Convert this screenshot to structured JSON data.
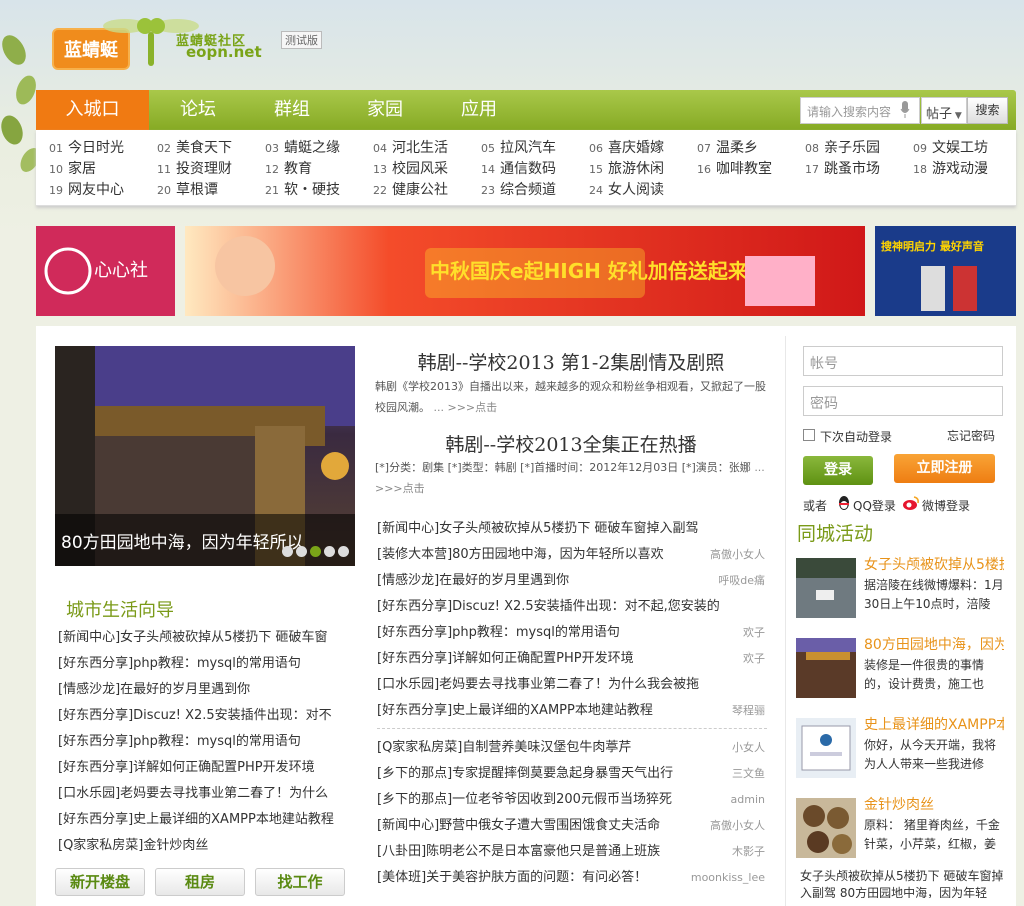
{
  "header": {
    "logo_text": "蓝蜻蜓",
    "site_name": "蓝蜻蜓社区",
    "site_domain": "eopn.net",
    "beta_label": "测试版"
  },
  "nav": {
    "tabs": [
      "入城口",
      "论坛",
      "群组",
      "家园",
      "应用"
    ]
  },
  "search": {
    "placeholder": "请输入搜索内容",
    "scope": "帖子",
    "button": "搜索"
  },
  "channels": [
    {
      "num": "01",
      "label": "今日时光"
    },
    {
      "num": "02",
      "label": "美食天下"
    },
    {
      "num": "03",
      "label": "蜻蜓之缘"
    },
    {
      "num": "04",
      "label": "河北生活"
    },
    {
      "num": "05",
      "label": "拉风汽车"
    },
    {
      "num": "06",
      "label": "喜庆婚嫁"
    },
    {
      "num": "07",
      "label": "温柔乡"
    },
    {
      "num": "08",
      "label": "亲子乐园"
    },
    {
      "num": "09",
      "label": "文娱工坊"
    },
    {
      "num": "10",
      "label": "家居"
    },
    {
      "num": "11",
      "label": "投资理财"
    },
    {
      "num": "12",
      "label": "教育"
    },
    {
      "num": "13",
      "label": "校园风采"
    },
    {
      "num": "14",
      "label": "通信数码"
    },
    {
      "num": "15",
      "label": "旅游休闲"
    },
    {
      "num": "16",
      "label": "咖啡教室"
    },
    {
      "num": "17",
      "label": "跳蚤市场"
    },
    {
      "num": "18",
      "label": "游戏动漫"
    },
    {
      "num": "19",
      "label": "网友中心"
    },
    {
      "num": "20",
      "label": "草根谭"
    },
    {
      "num": "21",
      "label": "软・硬技"
    },
    {
      "num": "22",
      "label": "健康公社"
    },
    {
      "num": "23",
      "label": "综合频道"
    },
    {
      "num": "24",
      "label": "女人阅读"
    }
  ],
  "banners": {
    "left": "心心社",
    "center": "中秋国庆e起HIGH 好礼加倍送起来",
    "right": "搜神明启力 最好声音"
  },
  "slideshow": {
    "caption": "80方田园地中海，因为年轻所以"
  },
  "city_guide": {
    "title": "城市生活向导",
    "items": [
      "[新闻中心]女子头颅被砍掉从5楼扔下 砸破车窗",
      "[好东西分享]php教程：mysql的常用语句",
      "[情感沙龙]在最好的岁月里遇到你",
      "[好东西分享]Discuz! X2.5安装插件出现：对不",
      "[好东西分享]php教程：mysql的常用语句",
      "[好东西分享]详解如何正确配置PHP开发环境",
      "[口水乐园]老妈要去寻找事业第二春了！为什么",
      "[好东西分享]史上最详细的XAMPP本地建站教程",
      "[Q家家私房菜]金针炒肉丝"
    ]
  },
  "quick_links": [
    "新开楼盘",
    "租房",
    "找工作"
  ],
  "headlines": [
    {
      "title": "韩剧--学校2013 第1-2集剧情及剧照",
      "summary": "韩剧《学校2013》自播出以来，越来越多的观众和粉丝争相观看，又掀起了一股校园风潮。",
      "more": "... >>>点击"
    },
    {
      "title": "韩剧--学校2013全集正在热播",
      "summary": "[*]分类：剧集 [*]类型：韩剧 [*]首播时间：2012年12月03日 [*]演员：张娜",
      "more": "... >>>点击"
    }
  ],
  "news_list_a": [
    {
      "text": "[新闻中心]女子头颅被砍掉从5楼扔下 砸破车窗掉入副驾",
      "author": ""
    },
    {
      "text": "[装修大本营]80方田园地中海，因为年轻所以喜欢",
      "author": "高傲小女人"
    },
    {
      "text": "[情感沙龙]在最好的岁月里遇到你",
      "author": "呼吸de痛"
    },
    {
      "text": "[好东西分享]Discuz! X2.5安装插件出现：对不起,您安装的",
      "author": ""
    },
    {
      "text": "[好东西分享]php教程：mysql的常用语句",
      "author": "欢子"
    },
    {
      "text": "[好东西分享]详解如何正确配置PHP开发环境",
      "author": "欢子"
    },
    {
      "text": "[口水乐园]老妈要去寻找事业第二春了！为什么我会被拖",
      "author": ""
    },
    {
      "text": "[好东西分享]史上最详细的XAMPP本地建站教程",
      "author": "琴程骊"
    }
  ],
  "news_list_b": [
    {
      "text": "[Q家家私房菜]自制营养美味汉堡包牛肉葶芹",
      "author": "小女人"
    },
    {
      "text": "[乡下的那点]专家提醒摔倒莫要急起身暴雪天气出行",
      "author": "三文鱼"
    },
    {
      "text": "[乡下的那点]一位老爷爷因收到200元假币当场猝死",
      "author": "admin"
    },
    {
      "text": "[新闻中心]野营中俄女子遭大雪围困饿食丈夫活命",
      "author": "高傲小女人"
    },
    {
      "text": "[八卦田]陈明老公不是日本富豪他只是普通上班族",
      "author": "木影子"
    },
    {
      "text": "[美体班]关于美容护肤方面的问题：有问必答！",
      "author": "moonkiss_lee"
    }
  ],
  "login": {
    "username_placeholder": "帐号",
    "password_placeholder": "密码",
    "remember": "下次自动登录",
    "forgot": "忘记密码",
    "login_btn": "登录",
    "register_btn": "立即注册",
    "or": "或者",
    "qq": "QQ登录",
    "weibo": "微博登录"
  },
  "events": {
    "title": "同城活动",
    "items": [
      {
        "title": "女子头颅被砍掉从5楼扔下 砸破车窗",
        "desc": "据涪陵在线微博爆料：1月30日上午10点时，涪陵"
      },
      {
        "title": "80方田园地中海，因为年轻所以喜欢",
        "desc": "装修是一件很贵的事情的，设计费贵，施工也贵，"
      },
      {
        "title": "史上最详细的XAMPP本地建站教程",
        "desc": "你好，从今天开端，我将为人人带来一些我进修"
      },
      {
        "title": "金针炒肉丝",
        "desc": "原料： 猪里脊肉丝，千金针菜，小芹菜，红椒，姜"
      }
    ],
    "footer": "女子头颅被砍掉从5楼扔下 砸破车窗掉入副驾 80方田园地中海，因为年轻"
  },
  "colors": {
    "accent_green": "#86aa24",
    "accent_orange": "#f07a12",
    "event_title": "#e8931a"
  }
}
